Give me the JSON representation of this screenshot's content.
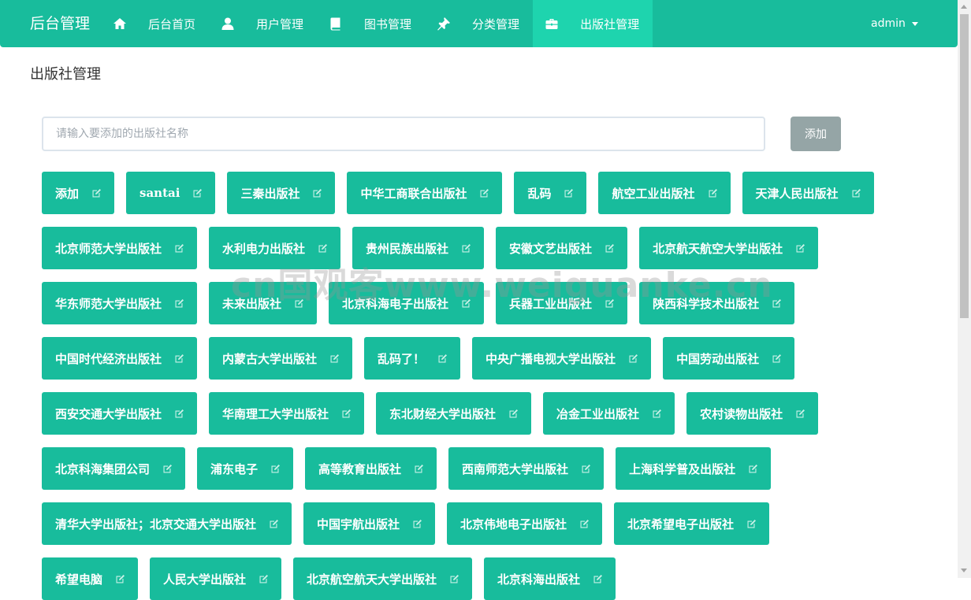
{
  "navbar": {
    "brand": "后台管理",
    "items": [
      {
        "icon": "home-icon",
        "label": "后台首页"
      },
      {
        "icon": "user-icon",
        "label": "用户管理"
      },
      {
        "icon": "book-icon",
        "label": "图书管理"
      },
      {
        "icon": "pushpin-icon",
        "label": "分类管理"
      },
      {
        "icon": "briefcase-icon",
        "label": "出版社管理"
      }
    ],
    "user_menu": "admin"
  },
  "page": {
    "title": "出版社管理"
  },
  "add_form": {
    "placeholder": "请输入要添加的出版社名称",
    "button_label": "添加"
  },
  "publishers": [
    "添加",
    "santai",
    "三秦出版社",
    "中华工商联合出版社",
    "乱码",
    "航空工业出版社",
    "天津人民出版社",
    "北京师范大学出版社",
    "水利电力出版社",
    "贵州民族出版社",
    "安徽文艺出版社",
    "北京航天航空大学出版社",
    "华东师范大学出版社",
    "未来出版社",
    "北京科海电子出版社",
    "兵器工业出版社",
    "陕西科学技术出版社",
    "中国时代经济出版社",
    "内蒙古大学出版社",
    "乱码了！",
    "中央广播电视大学出版社",
    "中国劳动出版社",
    "西安交通大学出版社",
    "华南理工大学出版社",
    "东北财经大学出版社",
    "冶金工业出版社",
    "农村读物出版社",
    "北京科海集团公司",
    "浦东电子",
    "高等教育出版社",
    "西南师范大学出版社",
    "上海科学普及出版社",
    "清华大学出版社；北京交通大学出版社",
    "中国宇航出版社",
    "北京伟地电子出版社",
    "北京希望电子出版社",
    "希望电脑",
    "人民大学出版社",
    "北京航空航天大学出版社",
    "北京科海出版社"
  ],
  "watermark": "cn国观客www.weiguanke.cn",
  "colors": {
    "primary": "#18bc9c",
    "active_nav": "#1ed4ae",
    "button_gray": "#95a5a6"
  }
}
